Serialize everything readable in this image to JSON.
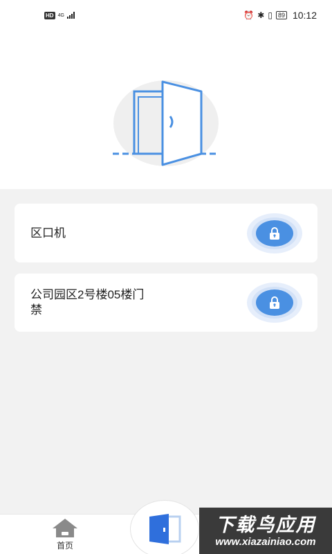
{
  "status_bar": {
    "hd": "HD",
    "network": "4G",
    "battery": "89",
    "time": "10:12"
  },
  "doors": [
    {
      "label": "区口机",
      "icon": "lock-icon"
    },
    {
      "label": "公司园区2号楼05楼门禁",
      "icon": "lock-icon"
    }
  ],
  "tabbar": {
    "home_label": "首页",
    "home_icon": "house-icon",
    "center_icon": "door-icon"
  },
  "watermark": {
    "title": "下载鸟应用",
    "url": "www.xiazainiao.com"
  },
  "colors": {
    "accent": "#4a90e2",
    "background": "#f2f2f2"
  }
}
